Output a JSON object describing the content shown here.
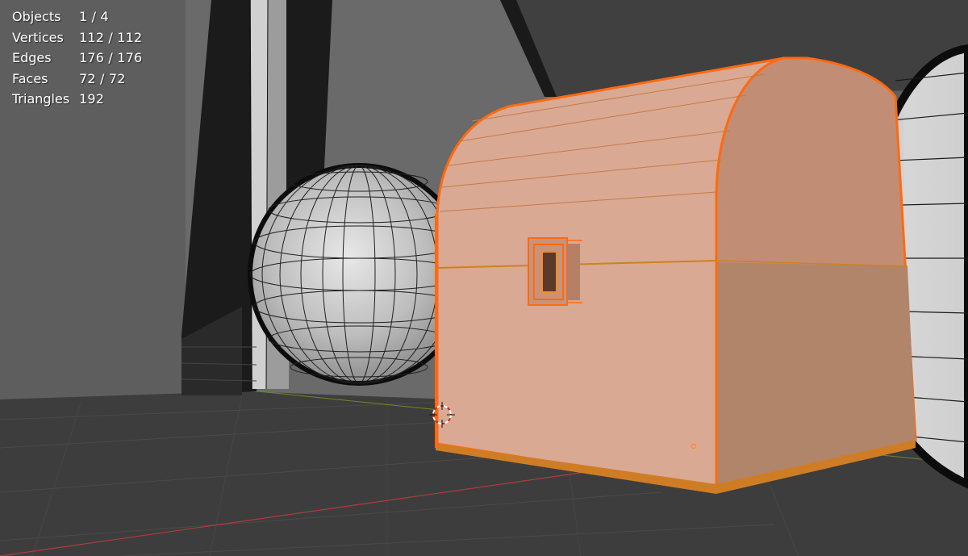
{
  "stats": {
    "objects": {
      "label": "Objects",
      "value": "1 / 4"
    },
    "vertices": {
      "label": "Vertices",
      "value": "112 / 112"
    },
    "edges": {
      "label": "Edges",
      "value": "176 / 176"
    },
    "faces": {
      "label": "Faces",
      "value": "72 / 72"
    },
    "triangles": {
      "label": "Triangles",
      "value": "192"
    }
  },
  "colors": {
    "floor": "#3c3c3c",
    "background_wall": "#5c5c5c",
    "selected_outline": "#ff7a1a",
    "selected_fill": "#d9a58c",
    "mesh_wire": "#111111",
    "mesh_surface": "#c6c6c6",
    "axis_x": "#b33a3a",
    "axis_y": "#6a8a2a"
  }
}
